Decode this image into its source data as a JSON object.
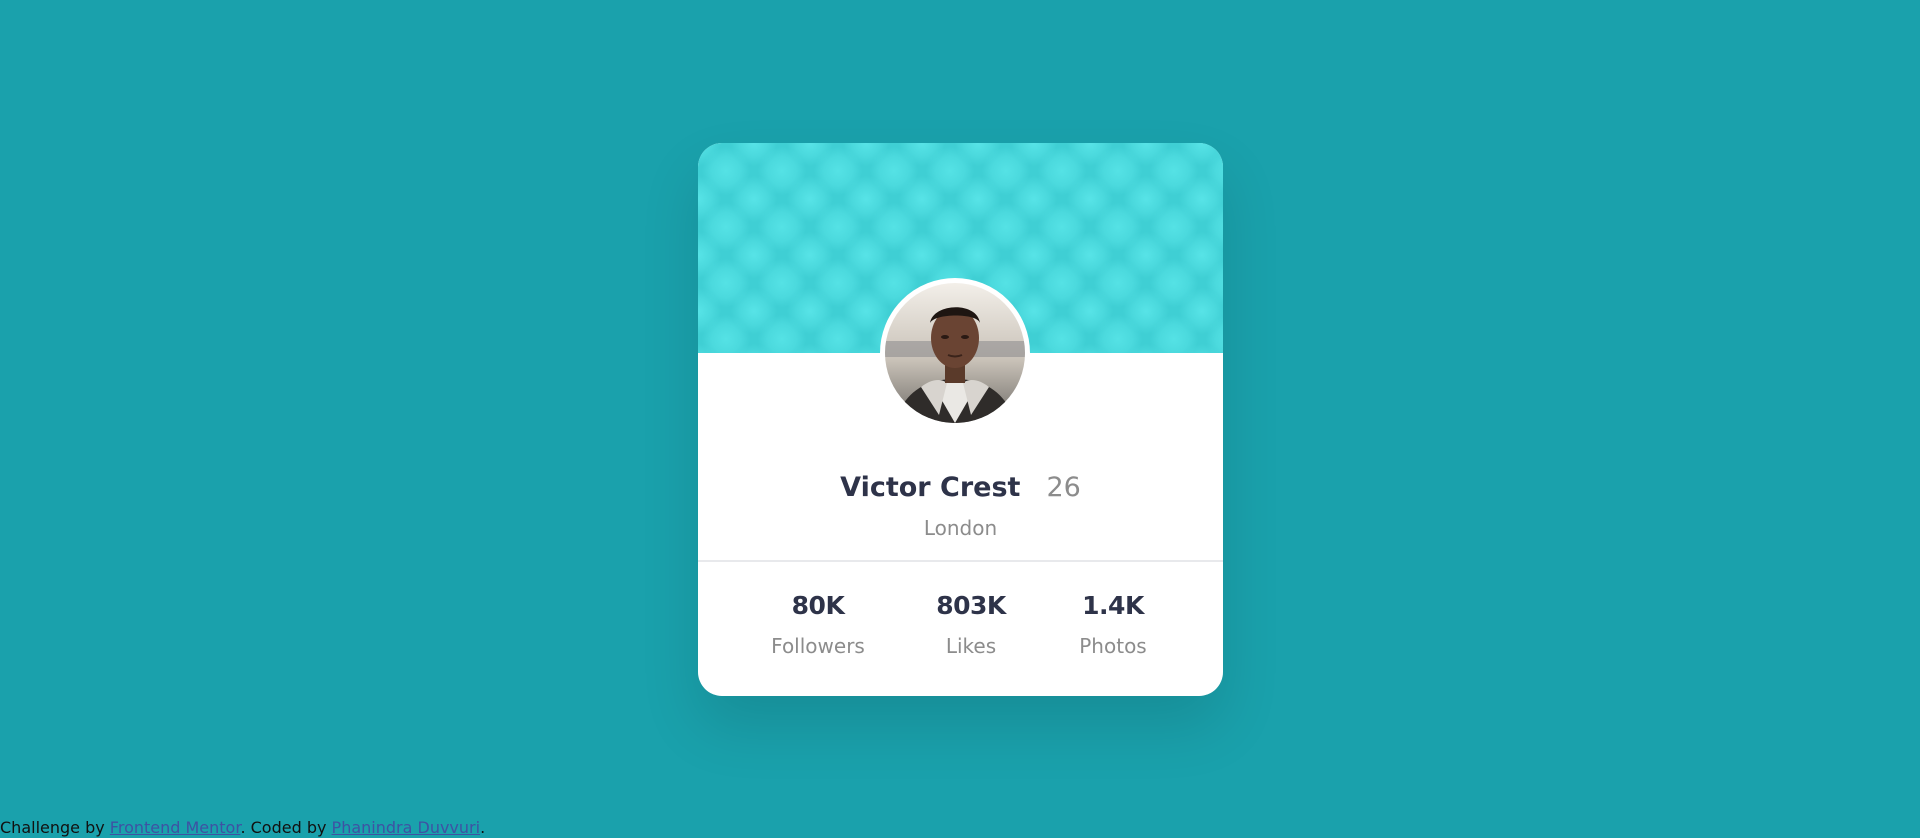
{
  "profile": {
    "name": "Victor Crest",
    "age": "26",
    "city": "London",
    "avatar_alt": "Victor Crest avatar"
  },
  "stats": [
    {
      "value": "80K",
      "label": "Followers"
    },
    {
      "value": "803K",
      "label": "Likes"
    },
    {
      "value": "1.4K",
      "label": "Photos"
    }
  ],
  "attribution": {
    "prefix": "Challenge by ",
    "link1": "Frontend Mentor",
    "middle": ". Coded by ",
    "link2": "Phanindra Duvvuri",
    "suffix": "."
  },
  "colors": {
    "background": "#1aa1ac",
    "card": "#ffffff",
    "header_pattern": "#3fcfd4",
    "text_dark": "#2e3349",
    "text_muted": "#8c8c8c",
    "link": "#3e52a3"
  }
}
